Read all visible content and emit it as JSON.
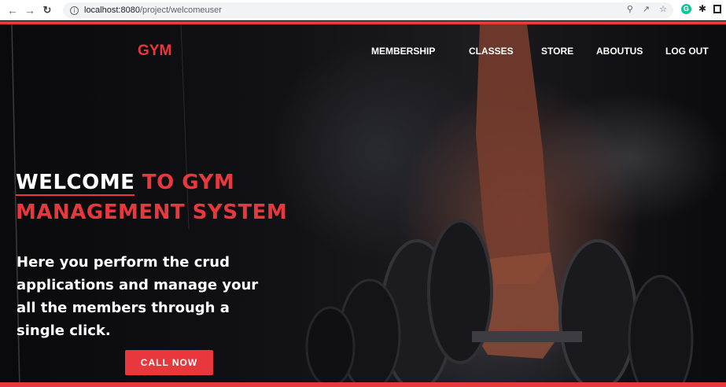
{
  "browser": {
    "url_host": "localhost:8080",
    "url_path": "/project/welcomeuser",
    "icons": [
      "back-arrow-icon",
      "forward-arrow-icon",
      "reload-icon",
      "info-icon",
      "key-icon",
      "share-icon",
      "star-icon",
      "grammarly-icon",
      "puzzle-icon",
      "window-icon"
    ]
  },
  "header": {
    "logo": "GYM",
    "nav": {
      "membership": "MEMBERSHIP",
      "classes": "CLASSES",
      "store": "STORE",
      "aboutus": "ABOUTUS",
      "logout": "LOG OUT"
    }
  },
  "hero": {
    "headline_white": "WELCOME",
    "headline_red_1": "TO GYM",
    "headline_red_2": "MANAGEMENT SYSTEM",
    "subtext": "Here you perform the crud applications and manage your all the members through a single click.",
    "cta": "CALL NOW"
  },
  "colors": {
    "accent": "#e8383d",
    "background": "#0b0b0d",
    "text": "#ffffff"
  }
}
